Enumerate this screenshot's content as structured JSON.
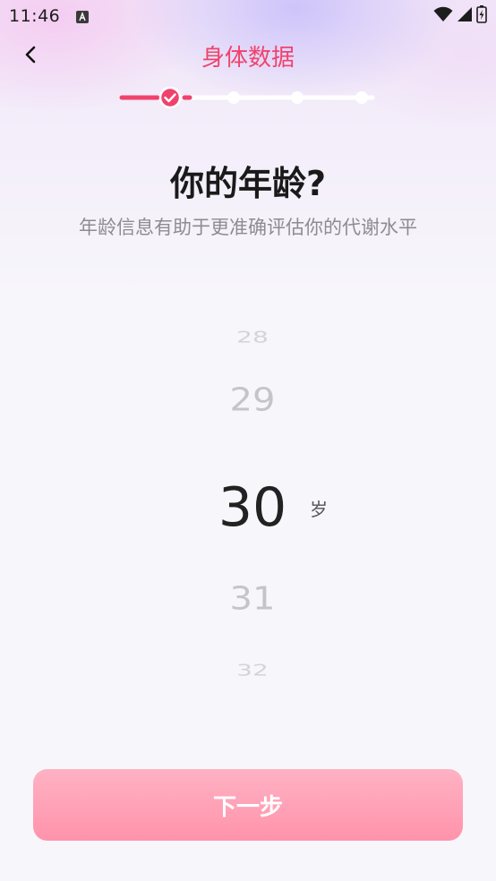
{
  "status_bar": {
    "time": "11:46",
    "notification_icon": "font-a-icon",
    "icons": [
      "wifi-icon",
      "signal-icon",
      "battery-icon"
    ]
  },
  "header": {
    "title": "身体数据",
    "back_icon": "chevron-left-icon"
  },
  "progress": {
    "total_steps": 5,
    "current_step": 1,
    "completed_step_icon": "check-icon",
    "accent_color": "#f0436c"
  },
  "content": {
    "question": "你的年龄?",
    "subtitle": "年龄信息有助于更准确评估你的代谢水平"
  },
  "picker": {
    "options": [
      "28",
      "29",
      "30",
      "31",
      "32"
    ],
    "selected": "30",
    "unit": "岁"
  },
  "footer": {
    "next_label": "下一步",
    "button_color": "#ff9fb5"
  }
}
